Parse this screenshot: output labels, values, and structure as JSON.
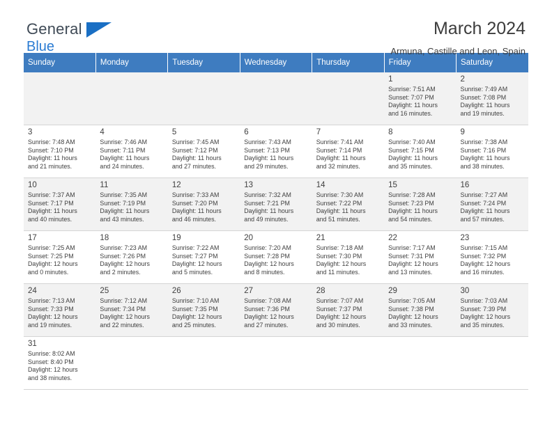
{
  "brand": {
    "line1": "General",
    "line2": "Blue",
    "flag_icon": "flag-shape"
  },
  "header": {
    "title": "March 2024",
    "location": "Armuna, Castille and Leon, Spain"
  },
  "calendar": {
    "weekdays": [
      "Sunday",
      "Monday",
      "Tuesday",
      "Wednesday",
      "Thursday",
      "Friday",
      "Saturday"
    ],
    "weeks": [
      [
        null,
        null,
        null,
        null,
        null,
        {
          "day": "1",
          "sunrise": "Sunrise: 7:51 AM",
          "sunset": "Sunset: 7:07 PM",
          "daylight1": "Daylight: 11 hours",
          "daylight2": "and 16 minutes."
        },
        {
          "day": "2",
          "sunrise": "Sunrise: 7:49 AM",
          "sunset": "Sunset: 7:08 PM",
          "daylight1": "Daylight: 11 hours",
          "daylight2": "and 19 minutes."
        }
      ],
      [
        {
          "day": "3",
          "sunrise": "Sunrise: 7:48 AM",
          "sunset": "Sunset: 7:10 PM",
          "daylight1": "Daylight: 11 hours",
          "daylight2": "and 21 minutes."
        },
        {
          "day": "4",
          "sunrise": "Sunrise: 7:46 AM",
          "sunset": "Sunset: 7:11 PM",
          "daylight1": "Daylight: 11 hours",
          "daylight2": "and 24 minutes."
        },
        {
          "day": "5",
          "sunrise": "Sunrise: 7:45 AM",
          "sunset": "Sunset: 7:12 PM",
          "daylight1": "Daylight: 11 hours",
          "daylight2": "and 27 minutes."
        },
        {
          "day": "6",
          "sunrise": "Sunrise: 7:43 AM",
          "sunset": "Sunset: 7:13 PM",
          "daylight1": "Daylight: 11 hours",
          "daylight2": "and 29 minutes."
        },
        {
          "day": "7",
          "sunrise": "Sunrise: 7:41 AM",
          "sunset": "Sunset: 7:14 PM",
          "daylight1": "Daylight: 11 hours",
          "daylight2": "and 32 minutes."
        },
        {
          "day": "8",
          "sunrise": "Sunrise: 7:40 AM",
          "sunset": "Sunset: 7:15 PM",
          "daylight1": "Daylight: 11 hours",
          "daylight2": "and 35 minutes."
        },
        {
          "day": "9",
          "sunrise": "Sunrise: 7:38 AM",
          "sunset": "Sunset: 7:16 PM",
          "daylight1": "Daylight: 11 hours",
          "daylight2": "and 38 minutes."
        }
      ],
      [
        {
          "day": "10",
          "sunrise": "Sunrise: 7:37 AM",
          "sunset": "Sunset: 7:17 PM",
          "daylight1": "Daylight: 11 hours",
          "daylight2": "and 40 minutes."
        },
        {
          "day": "11",
          "sunrise": "Sunrise: 7:35 AM",
          "sunset": "Sunset: 7:19 PM",
          "daylight1": "Daylight: 11 hours",
          "daylight2": "and 43 minutes."
        },
        {
          "day": "12",
          "sunrise": "Sunrise: 7:33 AM",
          "sunset": "Sunset: 7:20 PM",
          "daylight1": "Daylight: 11 hours",
          "daylight2": "and 46 minutes."
        },
        {
          "day": "13",
          "sunrise": "Sunrise: 7:32 AM",
          "sunset": "Sunset: 7:21 PM",
          "daylight1": "Daylight: 11 hours",
          "daylight2": "and 49 minutes."
        },
        {
          "day": "14",
          "sunrise": "Sunrise: 7:30 AM",
          "sunset": "Sunset: 7:22 PM",
          "daylight1": "Daylight: 11 hours",
          "daylight2": "and 51 minutes."
        },
        {
          "day": "15",
          "sunrise": "Sunrise: 7:28 AM",
          "sunset": "Sunset: 7:23 PM",
          "daylight1": "Daylight: 11 hours",
          "daylight2": "and 54 minutes."
        },
        {
          "day": "16",
          "sunrise": "Sunrise: 7:27 AM",
          "sunset": "Sunset: 7:24 PM",
          "daylight1": "Daylight: 11 hours",
          "daylight2": "and 57 minutes."
        }
      ],
      [
        {
          "day": "17",
          "sunrise": "Sunrise: 7:25 AM",
          "sunset": "Sunset: 7:25 PM",
          "daylight1": "Daylight: 12 hours",
          "daylight2": "and 0 minutes."
        },
        {
          "day": "18",
          "sunrise": "Sunrise: 7:23 AM",
          "sunset": "Sunset: 7:26 PM",
          "daylight1": "Daylight: 12 hours",
          "daylight2": "and 2 minutes."
        },
        {
          "day": "19",
          "sunrise": "Sunrise: 7:22 AM",
          "sunset": "Sunset: 7:27 PM",
          "daylight1": "Daylight: 12 hours",
          "daylight2": "and 5 minutes."
        },
        {
          "day": "20",
          "sunrise": "Sunrise: 7:20 AM",
          "sunset": "Sunset: 7:28 PM",
          "daylight1": "Daylight: 12 hours",
          "daylight2": "and 8 minutes."
        },
        {
          "day": "21",
          "sunrise": "Sunrise: 7:18 AM",
          "sunset": "Sunset: 7:30 PM",
          "daylight1": "Daylight: 12 hours",
          "daylight2": "and 11 minutes."
        },
        {
          "day": "22",
          "sunrise": "Sunrise: 7:17 AM",
          "sunset": "Sunset: 7:31 PM",
          "daylight1": "Daylight: 12 hours",
          "daylight2": "and 13 minutes."
        },
        {
          "day": "23",
          "sunrise": "Sunrise: 7:15 AM",
          "sunset": "Sunset: 7:32 PM",
          "daylight1": "Daylight: 12 hours",
          "daylight2": "and 16 minutes."
        }
      ],
      [
        {
          "day": "24",
          "sunrise": "Sunrise: 7:13 AM",
          "sunset": "Sunset: 7:33 PM",
          "daylight1": "Daylight: 12 hours",
          "daylight2": "and 19 minutes."
        },
        {
          "day": "25",
          "sunrise": "Sunrise: 7:12 AM",
          "sunset": "Sunset: 7:34 PM",
          "daylight1": "Daylight: 12 hours",
          "daylight2": "and 22 minutes."
        },
        {
          "day": "26",
          "sunrise": "Sunrise: 7:10 AM",
          "sunset": "Sunset: 7:35 PM",
          "daylight1": "Daylight: 12 hours",
          "daylight2": "and 25 minutes."
        },
        {
          "day": "27",
          "sunrise": "Sunrise: 7:08 AM",
          "sunset": "Sunset: 7:36 PM",
          "daylight1": "Daylight: 12 hours",
          "daylight2": "and 27 minutes."
        },
        {
          "day": "28",
          "sunrise": "Sunrise: 7:07 AM",
          "sunset": "Sunset: 7:37 PM",
          "daylight1": "Daylight: 12 hours",
          "daylight2": "and 30 minutes."
        },
        {
          "day": "29",
          "sunrise": "Sunrise: 7:05 AM",
          "sunset": "Sunset: 7:38 PM",
          "daylight1": "Daylight: 12 hours",
          "daylight2": "and 33 minutes."
        },
        {
          "day": "30",
          "sunrise": "Sunrise: 7:03 AM",
          "sunset": "Sunset: 7:39 PM",
          "daylight1": "Daylight: 12 hours",
          "daylight2": "and 35 minutes."
        }
      ],
      [
        {
          "day": "31",
          "sunrise": "Sunrise: 8:02 AM",
          "sunset": "Sunset: 8:40 PM",
          "daylight1": "Daylight: 12 hours",
          "daylight2": "and 38 minutes."
        },
        null,
        null,
        null,
        null,
        null,
        null
      ]
    ]
  },
  "colors": {
    "header_row": "#3e7cc0",
    "brand_blue": "#2b7cd3",
    "shade_row": "#f2f2f2"
  }
}
